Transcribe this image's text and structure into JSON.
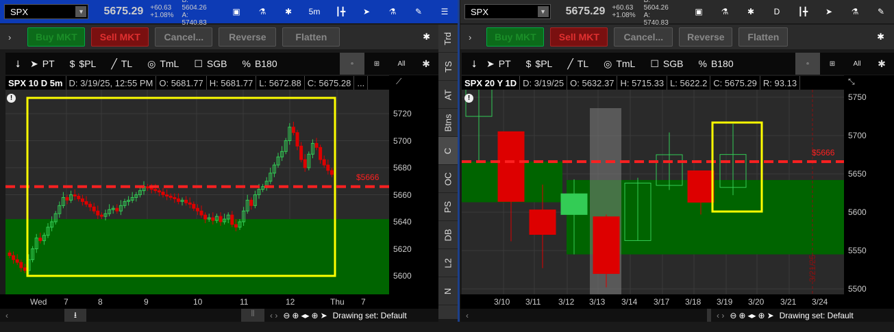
{
  "left": {
    "symbol": "SPX",
    "last": "5675.29",
    "change": "+60.63",
    "change_pct": "+1.08%",
    "bid": "B: 5604.26",
    "ask": "A: 5740.83",
    "header_icons": [
      "news-icon",
      "flask-icon",
      "gear-icon",
      "5m",
      "candle-style-icon",
      "cursor-icon",
      "study-icon",
      "drawing-icon",
      "menu-icon"
    ],
    "aggregation": "5m",
    "buttons": {
      "buy": "Buy MKT",
      "sell": "Sell MKT",
      "cancel": "Cancel...",
      "reverse": "Reverse",
      "flatten": "Flatten"
    },
    "toolbar": {
      "pt": "PT",
      "spl": "$PL",
      "tl": "TL",
      "tml": "TmL",
      "sgb": "SGB",
      "b180": "B180",
      "all": "All"
    },
    "info": {
      "title": "SPX 10 D 5m",
      "date": "D: 3/19/25, 12:55 PM",
      "open": "O: 5681.77",
      "high": "H: 5681.77",
      "low": "L: 5672.88",
      "close": "C: 5675.28",
      "more": "..."
    },
    "tabs": [
      "Trd",
      "TS",
      "AT",
      "Btns",
      "C",
      "OC",
      "PS",
      "DB",
      "L2",
      "N"
    ],
    "price_line_label": "$5666",
    "drawing_set": "Drawing set: Default"
  },
  "right": {
    "symbol": "SPX",
    "last": "5675.29",
    "change": "+60.63",
    "change_pct": "+1.08%",
    "bid": "B: 5604.26",
    "ask": "A: 5740.83",
    "aggregation": "D",
    "buttons": {
      "buy": "Buy MKT",
      "sell": "Sell MKT",
      "cancel": "Cancel...",
      "reverse": "Reverse",
      "flatten": "Flatten"
    },
    "toolbar": {
      "pt": "PT",
      "spl": "$PL",
      "tl": "TL",
      "tml": "TmL",
      "sgb": "SGB",
      "b180": "B180",
      "all": "All"
    },
    "info": {
      "title": "SPX 20 Y 1D",
      "date": "D: 3/19/25",
      "open": "O: 5632.37",
      "high": "H: 5715.33",
      "low": "L: 5622.2",
      "close": "C: 5675.29",
      "range": "R: 93.13"
    },
    "price_line_label": "$5666",
    "vertical_line_label": "3/21/25",
    "drawing_set": "Drawing set: Default"
  },
  "chart_data": [
    {
      "type": "candlestick",
      "title": "SPX 10 D 5m",
      "ylim": [
        5585,
        5735
      ],
      "yticks": [
        5600,
        5620,
        5640,
        5660,
        5680,
        5700,
        5720
      ],
      "xlabels": [
        "Wed",
        "7",
        "8",
        "9",
        "10",
        "11",
        "12",
        "Thu",
        "7"
      ],
      "closes": [
        5615,
        5612,
        5610,
        5606,
        5604,
        5612,
        5620,
        5628,
        5626,
        5630,
        5636,
        5640,
        5646,
        5652,
        5658,
        5656,
        5660,
        5659,
        5657,
        5655,
        5653,
        5651,
        5648,
        5645,
        5644,
        5646,
        5649,
        5650,
        5648,
        5652,
        5655,
        5656,
        5658,
        5660,
        5663,
        5666,
        5665,
        5664,
        5663,
        5662,
        5660,
        5659,
        5658,
        5657,
        5655,
        5656,
        5654,
        5653,
        5650,
        5648,
        5645,
        5642,
        5643,
        5641,
        5644,
        5640,
        5642,
        5645,
        5638,
        5636,
        5640,
        5648,
        5656,
        5652,
        5660,
        5664,
        5666,
        5670,
        5676,
        5682,
        5688,
        5692,
        5700,
        5710,
        5706,
        5696,
        5686,
        5680,
        5690,
        5698,
        5695,
        5686,
        5682,
        5678,
        5675
      ],
      "price_line": 5666,
      "zone": [
        5642,
        5585
      ],
      "colors": {
        "up": "#33cc55",
        "down": "#dd0000",
        "zone": "#006400",
        "line": "#ff2020",
        "box": "#ffff00"
      }
    },
    {
      "type": "candlestick",
      "title": "SPX 20 Y 1D",
      "ylim": [
        5495,
        5760
      ],
      "yticks": [
        5500,
        5550,
        5600,
        5650,
        5700,
        5750
      ],
      "xlabels": [
        "3/10",
        "3/11",
        "3/12",
        "3/13",
        "3/14",
        "3/17",
        "3/18",
        "3/19",
        "3/20",
        "3/21",
        "3/24"
      ],
      "candles": [
        {
          "d": "3/7",
          "o": 5725,
          "h": 5775,
          "l": 5666,
          "c": 5770,
          "style": "hollow"
        },
        {
          "d": "3/10",
          "o": 5705,
          "h": 5705,
          "l": 5562,
          "c": 5614,
          "style": "down"
        },
        {
          "d": "3/11",
          "o": 5603,
          "h": 5636,
          "l": 5527,
          "c": 5571,
          "style": "down"
        },
        {
          "d": "3/12",
          "o": 5597,
          "h": 5643,
          "l": 5545,
          "c": 5624,
          "style": "solid"
        },
        {
          "d": "3/13",
          "o": 5594,
          "h": 5597,
          "l": 5502,
          "c": 5520,
          "style": "down"
        },
        {
          "d": "3/14",
          "o": 5563,
          "h": 5645,
          "l": 5563,
          "c": 5638,
          "style": "hollow"
        },
        {
          "d": "3/17",
          "o": 5635,
          "h": 5704,
          "l": 5629,
          "c": 5675,
          "style": "hollow"
        },
        {
          "d": "3/18",
          "o": 5654,
          "h": 5654,
          "l": 5597,
          "c": 5613,
          "style": "down"
        },
        {
          "d": "3/19",
          "o": 5632.37,
          "h": 5715.33,
          "l": 5622.2,
          "c": 5675.29,
          "style": "hollow"
        }
      ],
      "price_line": 5666,
      "zones": [
        [
          5666,
          5613
        ],
        [
          5642,
          5545
        ]
      ],
      "colors": {
        "up": "#33cc55",
        "down": "#dd0000",
        "zone": "#006400",
        "line": "#ff2020",
        "box": "#ffff00"
      }
    }
  ]
}
